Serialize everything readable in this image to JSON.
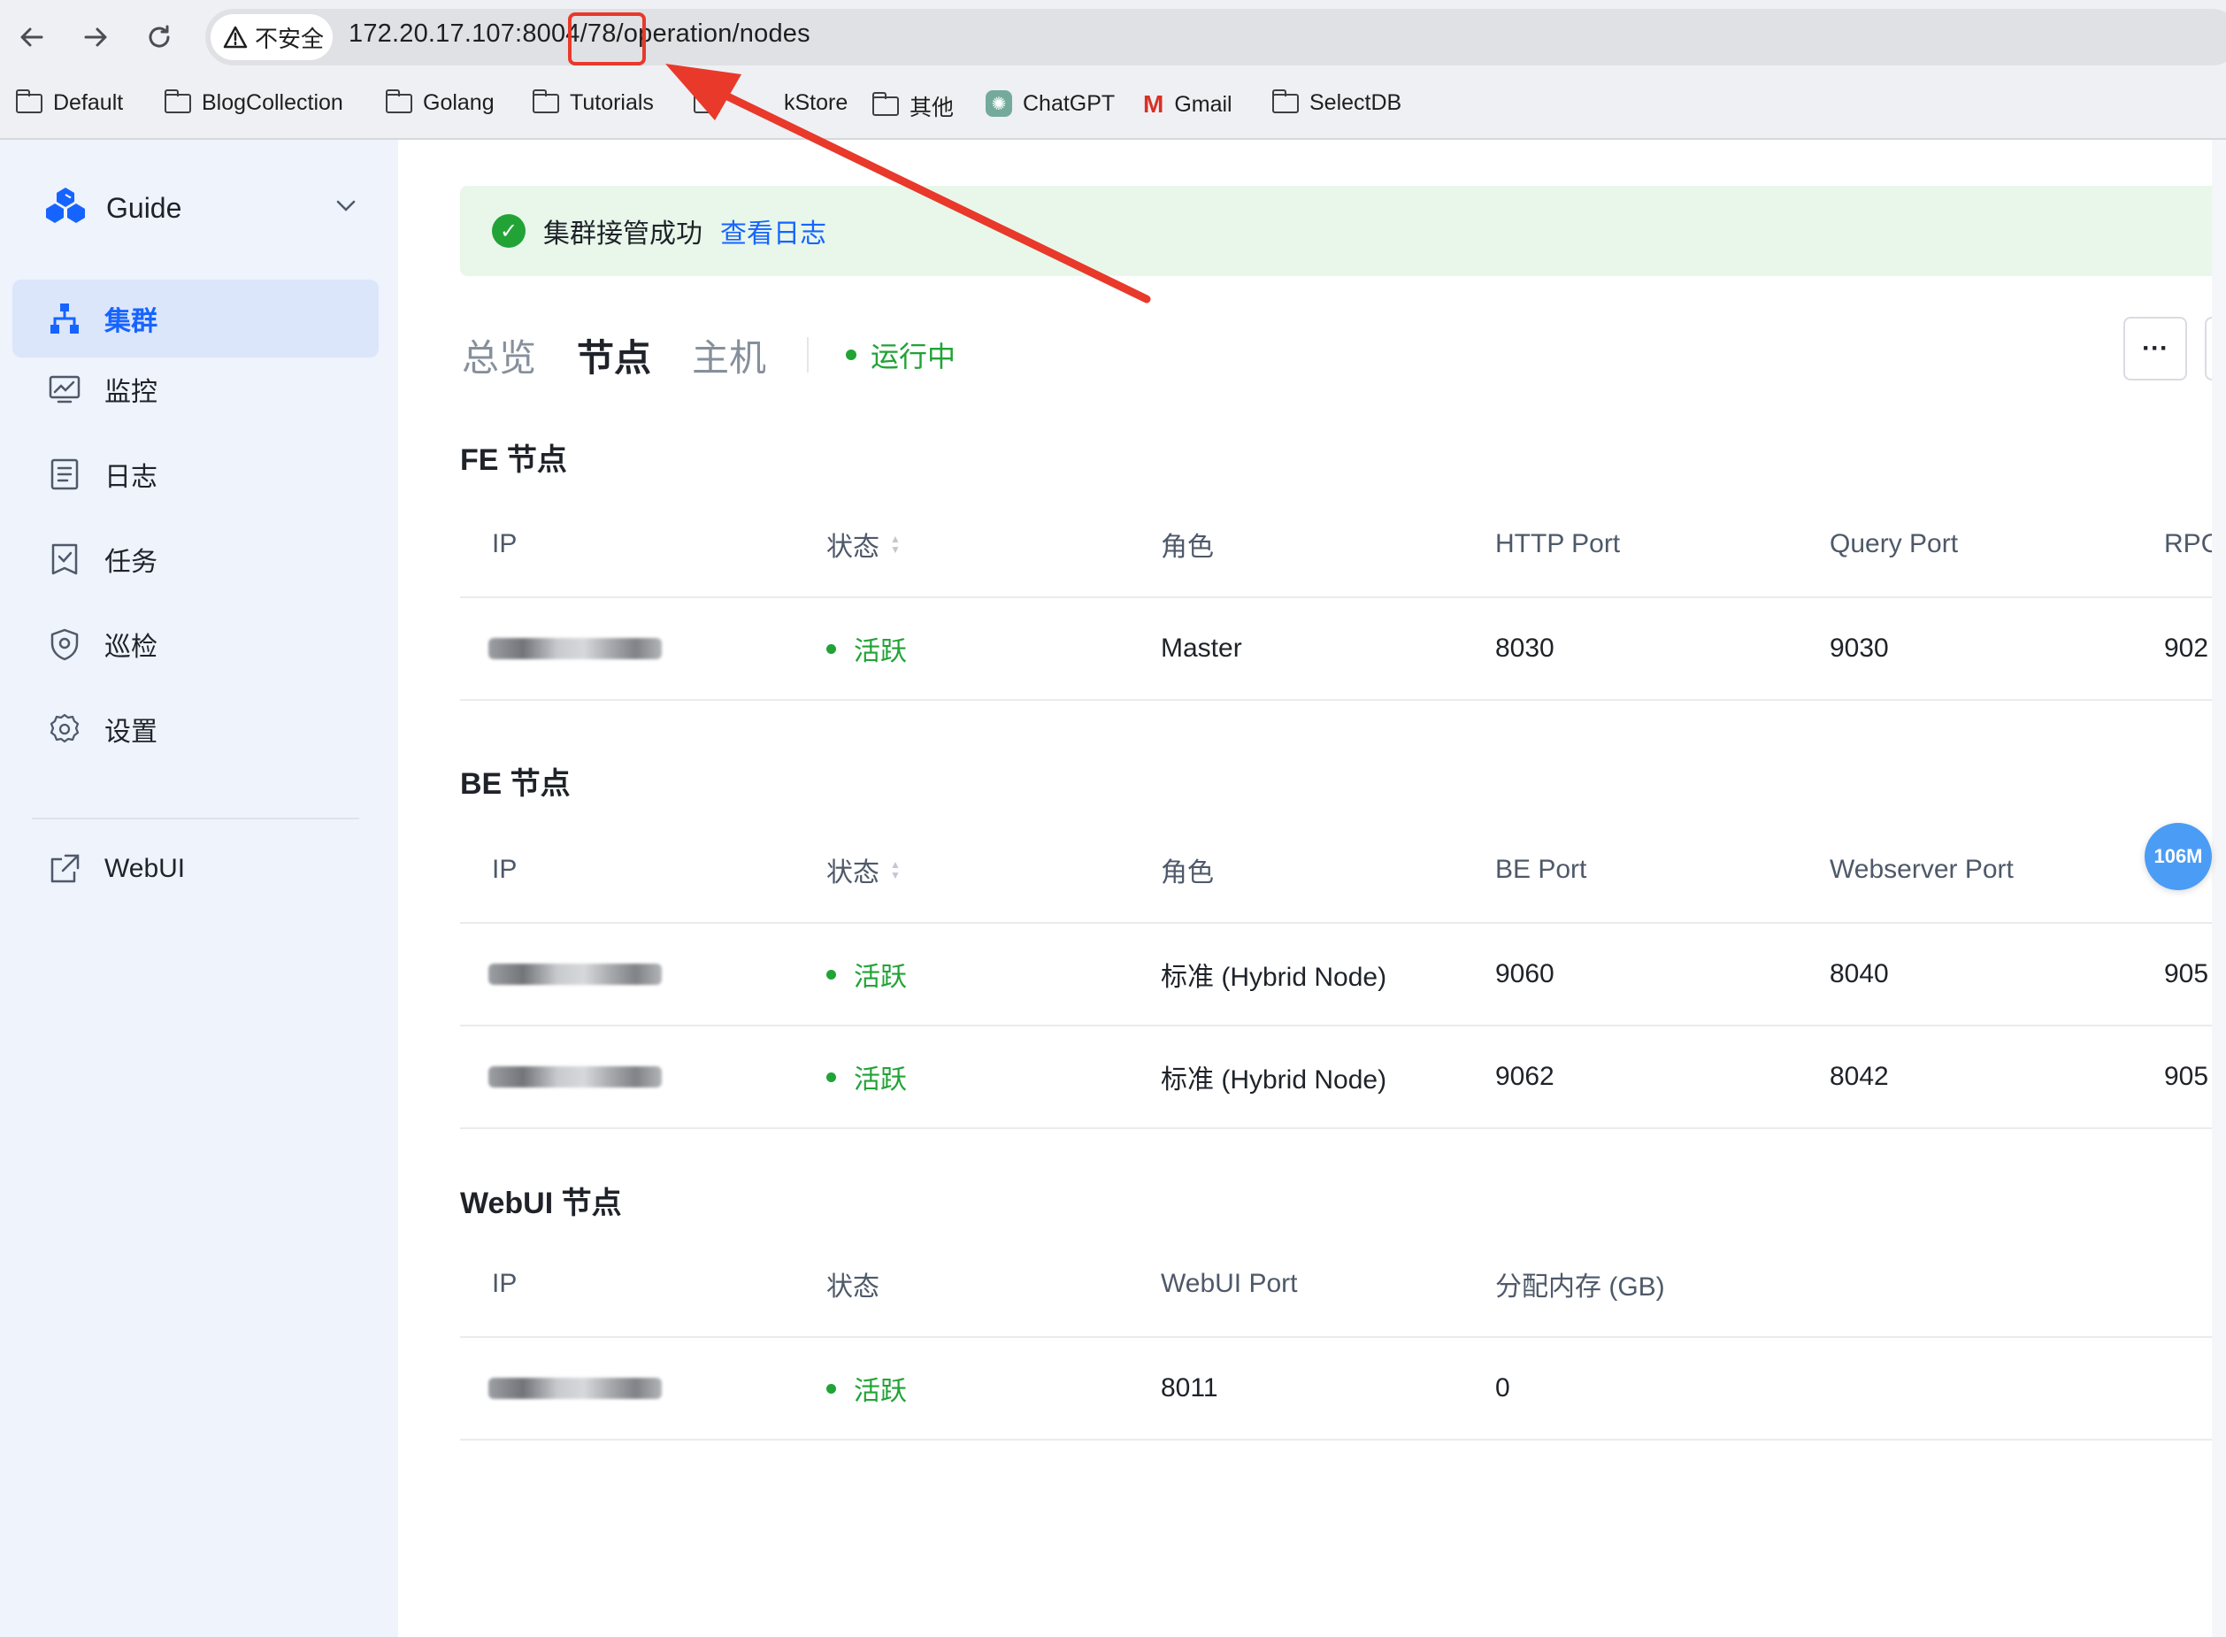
{
  "browser": {
    "security_label": "不安全",
    "url_main": "172.20.17.107:8004/78/operation/nodes",
    "bookmarks": [
      {
        "label": "Default",
        "icon": "folder-icon"
      },
      {
        "label": "BlogCollection",
        "icon": "folder-icon"
      },
      {
        "label": "Golang",
        "icon": "folder-icon"
      },
      {
        "label": "Tutorials",
        "icon": "folder-icon"
      },
      {
        "label": "kStore",
        "icon": "folder-icon"
      },
      {
        "label": "其他",
        "icon": "folder-icon"
      },
      {
        "label": "ChatGPT",
        "icon": "chatgpt-icon"
      },
      {
        "label": "Gmail",
        "icon": "gmail-icon"
      },
      {
        "label": "SelectDB",
        "icon": "folder-icon"
      }
    ]
  },
  "sidebar": {
    "brand": "Guide",
    "items": [
      {
        "label": "集群",
        "icon": "cluster-icon",
        "active": true
      },
      {
        "label": "监控",
        "icon": "monitor-icon"
      },
      {
        "label": "日志",
        "icon": "log-icon"
      },
      {
        "label": "任务",
        "icon": "task-icon"
      },
      {
        "label": "巡检",
        "icon": "inspect-icon"
      },
      {
        "label": "设置",
        "icon": "settings-icon"
      }
    ],
    "webui": "WebUI"
  },
  "alert": {
    "message": "集群接管成功",
    "link": "查看日志"
  },
  "tabs": [
    "总览",
    "节点",
    "主机"
  ],
  "active_tab": "节点",
  "cluster_status": "运行中",
  "more_label": "···",
  "fe": {
    "title": "FE 节点",
    "headers": [
      "IP",
      "状态",
      "角色",
      "HTTP Port",
      "Query Port",
      "RPC"
    ],
    "rows": [
      {
        "status": "活跃",
        "role": "Master",
        "http": "8030",
        "query": "9030",
        "rpc": "902"
      }
    ]
  },
  "be": {
    "title": "BE 节点",
    "headers": [
      "IP",
      "状态",
      "角色",
      "BE Port",
      "Webserver Port"
    ],
    "rows": [
      {
        "status": "活跃",
        "role": "标准 (Hybrid Node)",
        "be_port": "9060",
        "web_port": "8040",
        "extra": "905"
      },
      {
        "status": "活跃",
        "role": "标准 (Hybrid Node)",
        "be_port": "9062",
        "web_port": "8042",
        "extra": "905"
      }
    ]
  },
  "webui": {
    "title": "WebUI 节点",
    "headers": [
      "IP",
      "状态",
      "WebUI Port",
      "分配内存 (GB)"
    ],
    "rows": [
      {
        "status": "活跃",
        "port": "8011",
        "mem": "0"
      }
    ]
  },
  "floating_badge": "106M",
  "colors": {
    "accent": "#1664ff",
    "success": "#21a336",
    "annotation": "#e8392b"
  }
}
